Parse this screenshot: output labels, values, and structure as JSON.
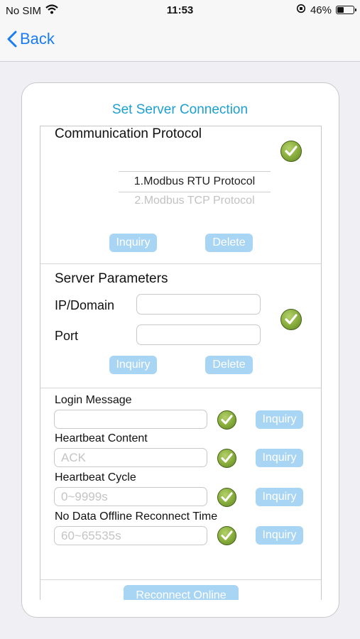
{
  "status": {
    "carrier": "No SIM",
    "time": "11:53",
    "battery_percent": "46%",
    "battery_level": 0.46
  },
  "nav": {
    "back": "Back"
  },
  "card": {
    "title": "Set Server Connection"
  },
  "protocol": {
    "title": "Communication Protocol",
    "options": [
      "1.Modbus RTU Protocol",
      "2.Modbus TCP Protocol"
    ],
    "inquiry": "Inquiry",
    "delete": "Delete"
  },
  "server": {
    "title": "Server Parameters",
    "ip_label": "IP/Domain",
    "port_label": "Port",
    "inquiry": "Inquiry",
    "delete": "Delete"
  },
  "fields": [
    {
      "label": "Login Message",
      "placeholder": "",
      "button": "Inquiry"
    },
    {
      "label": "Heartbeat Content",
      "placeholder": "ACK",
      "button": "Inquiry"
    },
    {
      "label": "Heartbeat Cycle",
      "placeholder": "0~9999s",
      "button": "Inquiry"
    },
    {
      "label": "No Data Offline Reconnect Time",
      "placeholder": "60~65535s",
      "button": "Inquiry"
    }
  ],
  "reconnect": "Reconnect Online",
  "colors": {
    "accent": "#1d9fcf",
    "link": "#1a7cf3",
    "button": "#a9d5f5",
    "check": "#86ab3a"
  }
}
